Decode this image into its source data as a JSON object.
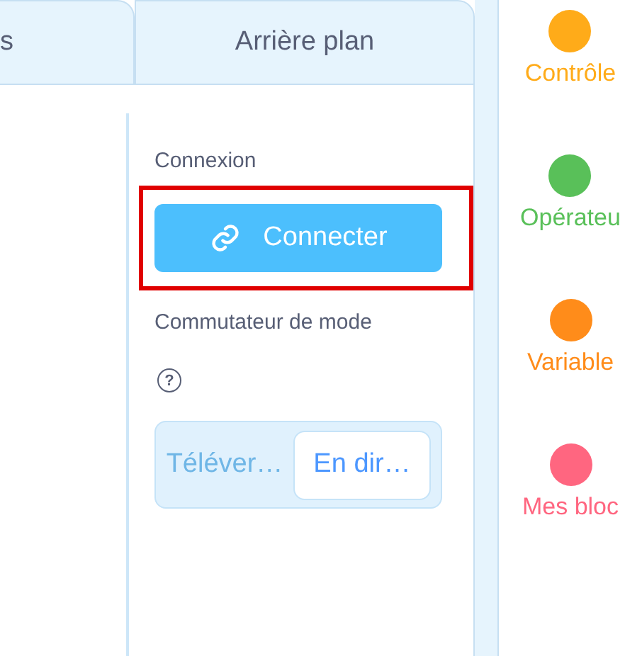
{
  "tabs": [
    {
      "label": "s",
      "selected": false
    },
    {
      "label": "Arrière plan",
      "selected": false
    }
  ],
  "connection": {
    "label": "Connexion",
    "button": "Connecter",
    "highlighted": true
  },
  "mode_switch": {
    "label": "Commutateur de mode",
    "help": "?",
    "options": [
      {
        "label": "Téléver…",
        "selected": false
      },
      {
        "label": "En dir…",
        "selected": true
      }
    ]
  },
  "categories": [
    {
      "label": "Contrôle",
      "color": "#ffab19"
    },
    {
      "label": "Opérateu",
      "color": "#59c059"
    },
    {
      "label": "Variable",
      "color": "#ff8c1a"
    },
    {
      "label": "Mes bloc",
      "color": "#ff6680"
    }
  ]
}
